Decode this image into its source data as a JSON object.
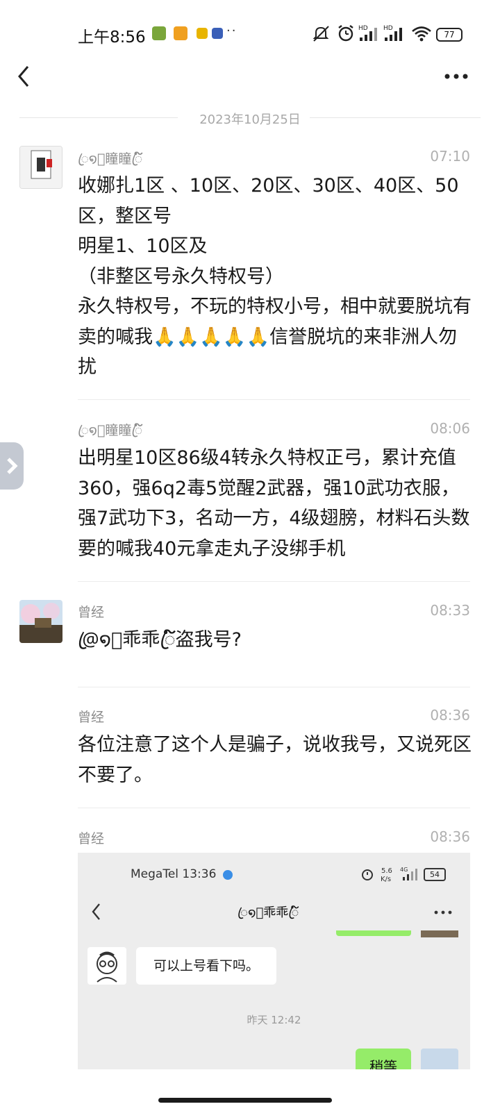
{
  "status_bar": {
    "time": "上午8:56",
    "more_dots": "··",
    "hd_label": "HD",
    "battery": "77"
  },
  "chat": {
    "date_divider": "2023年10月25日",
    "messages": [
      {
        "sender": "ꦿ໑⃰瞳瞳ꦿ໌໌",
        "time": "07:10",
        "text": "收娜扎1区 、10区、20区、30区、40区、50区，整区号\n明星1、10区及\n（非整区号永久特权号）\n永久特权号，不玩的特权小号，相中就要脱坑有卖的喊我🙏🙏🙏🙏🙏信誉脱坑的来非洲人勿扰"
      },
      {
        "sender": "ꦿ໑⃰瞳瞳ꦿ໌໌",
        "time": "08:06",
        "text": "出明星10区86级4转永久特权正弓，累计充值360，强6q2毒5觉醒2武器，强10武功衣服，强7武功下3，名动一方，4级翅膀，材料石头数要的喊我40元拿走丸子没绑手机"
      },
      {
        "sender": "曾经",
        "time": "08:33",
        "text": "@ꦿ໑⃰乖乖ꦿ໌໌盗我号?"
      },
      {
        "sender": "曾经",
        "time": "08:36",
        "text": "各位注意了这个人是骗子，说收我号，又说死区不要了。"
      },
      {
        "sender": "曾经",
        "time": "08:36"
      }
    ]
  },
  "shot": {
    "status": "MegaTel 13:36",
    "speed_top": "5.6",
    "speed_bottom": "K/s",
    "net": "4G",
    "battery": "54",
    "title": "ꦿ໑⃰乖乖ꦿ໌",
    "bubble": "可以上号看下吗。",
    "timestamp": "昨天 12:42",
    "green_bubble": "稍等"
  }
}
